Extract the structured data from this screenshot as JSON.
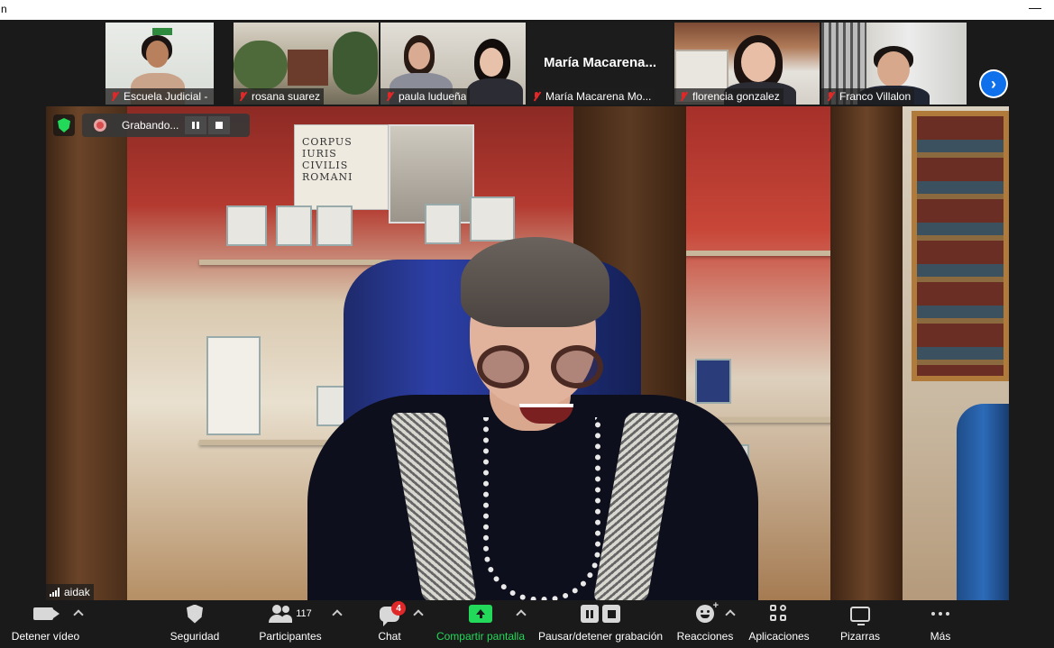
{
  "window": {
    "title_fragment": "n",
    "minimize_glyph": "—"
  },
  "gallery": {
    "participants": [
      {
        "name": "Escuela Judicial - Tania",
        "muted": true,
        "video": true
      },
      {
        "name": "rosana suarez",
        "muted": true,
        "video": true
      },
      {
        "name": "paula ludueña",
        "muted": true,
        "video": true
      },
      {
        "name": "María Macarena Mo...",
        "display_name": "María  Macarena...",
        "muted": true,
        "video": false
      },
      {
        "name": "florencia gonzalez",
        "muted": true,
        "video": true
      },
      {
        "name": "Franco Villalon",
        "muted": true,
        "video": true
      }
    ],
    "next_page_glyph": "›"
  },
  "main_video": {
    "speaker_name": "aidak",
    "book_title": "CORPUS IURIS CIVILIS ROMANI"
  },
  "recording": {
    "status_text": "Grabando..."
  },
  "toolbar": {
    "items": [
      {
        "label": "Detener vídeo",
        "icon": "video-camera-icon"
      },
      {
        "label": "Seguridad",
        "icon": "shield-icon"
      },
      {
        "label": "Participantes",
        "icon": "participants-icon",
        "count": "117"
      },
      {
        "label": "Chat",
        "icon": "chat-icon",
        "badge": "4"
      },
      {
        "label": "Compartir pantalla",
        "icon": "share-screen-icon"
      },
      {
        "label": "Pausar/detener grabación",
        "icon": "pause-stop-recording-icon"
      },
      {
        "label": "Reacciones",
        "icon": "reactions-icon"
      },
      {
        "label": "Aplicaciones",
        "icon": "apps-icon"
      },
      {
        "label": "Pizarras",
        "icon": "whiteboard-icon"
      },
      {
        "label": "Más",
        "icon": "more-icon"
      }
    ]
  },
  "colors": {
    "background": "#1a1a1a",
    "accent_green": "#23d959",
    "muted_red": "#e02828",
    "next_blue": "#0e71eb"
  }
}
